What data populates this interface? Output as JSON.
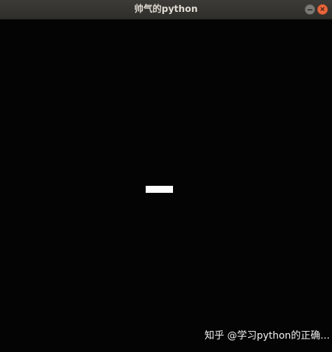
{
  "window": {
    "title": "帅气的python"
  },
  "titlebar_buttons": {
    "minimize_icon": "minimize-icon",
    "close_icon": "close-icon",
    "close_glyph": "×"
  },
  "game": {
    "background_color": "#040404",
    "block_color": "#ffffff"
  },
  "watermark": {
    "text": "知乎 @学习python的正确..."
  }
}
